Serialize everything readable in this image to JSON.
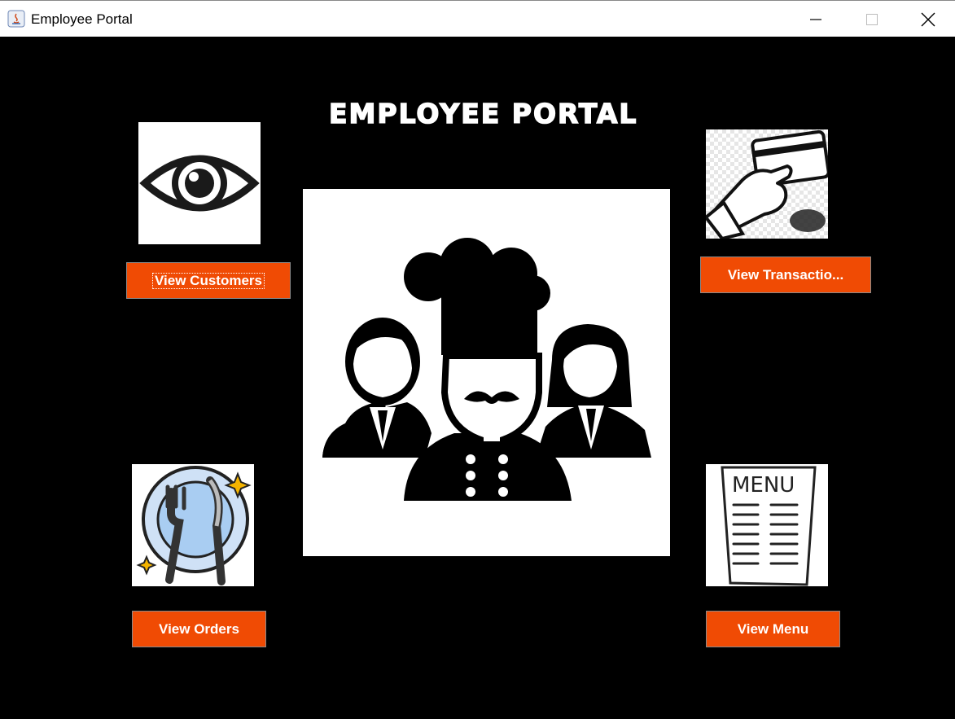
{
  "window": {
    "title": "Employee Portal"
  },
  "header": {
    "title": "EMPLOYEE PORTAL"
  },
  "buttons": {
    "customers": "View Customers",
    "transactions": "View Transactio...",
    "orders": "View Orders",
    "menu": "View Menu"
  },
  "menu_card": {
    "heading": "MENU"
  },
  "colors": {
    "button_bg": "#f04b04",
    "background": "#000000",
    "titlebar": "#ffffff"
  }
}
